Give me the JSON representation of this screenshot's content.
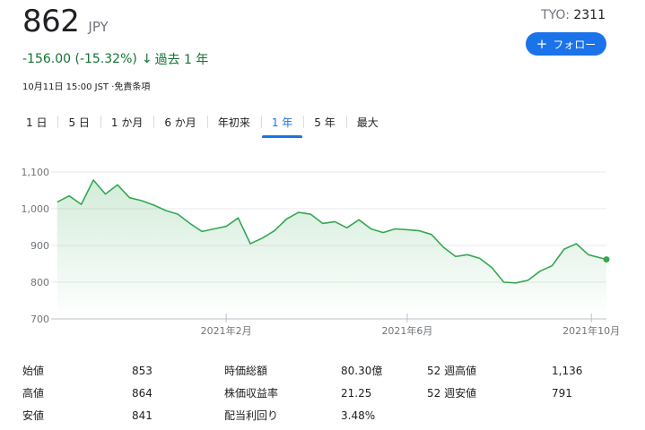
{
  "quote": {
    "price": "862",
    "currency": "JPY",
    "exchange": "TYO: ",
    "symbol": "2311",
    "change": "-156.00 (-15.32%)",
    "arrow": "↓",
    "period": "過去 1 年",
    "timestamp": "10月11日 15:00 JST ·免責条項"
  },
  "follow_button": {
    "label": "フォロー",
    "icon": "plus-icon"
  },
  "tabs": [
    {
      "label": "1 日",
      "active": false
    },
    {
      "label": "5 日",
      "active": false
    },
    {
      "label": "1 か月",
      "active": false
    },
    {
      "label": "6 か月",
      "active": false
    },
    {
      "label": "年初来",
      "active": false
    },
    {
      "label": "1 年",
      "active": true
    },
    {
      "label": "5 年",
      "active": false
    },
    {
      "label": "最大",
      "active": false
    }
  ],
  "colors": {
    "line": "#34a853",
    "accent": "#1a73e8",
    "negative": "#137333"
  },
  "chart_data": {
    "type": "area",
    "ylim": [
      700,
      1100
    ],
    "yticks": [
      "1,100",
      "1,000",
      "900",
      "800",
      "700"
    ],
    "x_range": [
      "2020-10-11",
      "2021-10-11"
    ],
    "xticks": [
      {
        "date": "2021-02-01",
        "label": "2021年2月"
      },
      {
        "date": "2021-06-01",
        "label": "2021年6月"
      },
      {
        "date": "2021-10-01",
        "label": "2021年10月"
      }
    ],
    "grid": true,
    "series": [
      {
        "x": [
          "2020-10-12",
          "2020-10-20",
          "2020-10-28",
          "2020-11-05",
          "2020-11-13",
          "2020-11-21",
          "2020-11-29",
          "2020-12-07",
          "2020-12-15",
          "2020-12-23",
          "2020-12-31",
          "2021-01-08",
          "2021-01-16",
          "2021-01-24",
          "2021-02-01",
          "2021-02-09",
          "2021-02-17",
          "2021-02-25",
          "2021-03-05",
          "2021-03-13",
          "2021-03-21",
          "2021-03-29",
          "2021-04-06",
          "2021-04-14",
          "2021-04-22",
          "2021-04-30",
          "2021-05-08",
          "2021-05-16",
          "2021-05-24",
          "2021-06-01",
          "2021-06-09",
          "2021-06-17",
          "2021-06-25",
          "2021-07-03",
          "2021-07-11",
          "2021-07-19",
          "2021-07-27",
          "2021-08-04",
          "2021-08-12",
          "2021-08-20",
          "2021-08-28",
          "2021-09-05",
          "2021-09-13",
          "2021-09-21",
          "2021-09-29",
          "2021-10-11"
        ],
        "y": [
          1018,
          1035,
          1012,
          1078,
          1040,
          1065,
          1030,
          1022,
          1010,
          995,
          985,
          960,
          938,
          945,
          952,
          975,
          905,
          920,
          940,
          972,
          990,
          985,
          960,
          965,
          948,
          970,
          945,
          935,
          945,
          943,
          940,
          930,
          895,
          870,
          875,
          865,
          840,
          800,
          798,
          805,
          830,
          845,
          890,
          905,
          875,
          862
        ]
      }
    ]
  },
  "stats": [
    [
      {
        "label": "始値",
        "value": "853"
      },
      {
        "label": "時価総額",
        "value": "80.30億"
      },
      {
        "label": "52 週高値",
        "value": "1,136"
      }
    ],
    [
      {
        "label": "高値",
        "value": "864"
      },
      {
        "label": "株価収益率",
        "value": "21.25"
      },
      {
        "label": "52 週安値",
        "value": "791"
      }
    ],
    [
      {
        "label": "安値",
        "value": "841"
      },
      {
        "label": "配当利回り",
        "value": "3.48%"
      },
      {
        "label": "",
        "value": ""
      }
    ]
  ]
}
